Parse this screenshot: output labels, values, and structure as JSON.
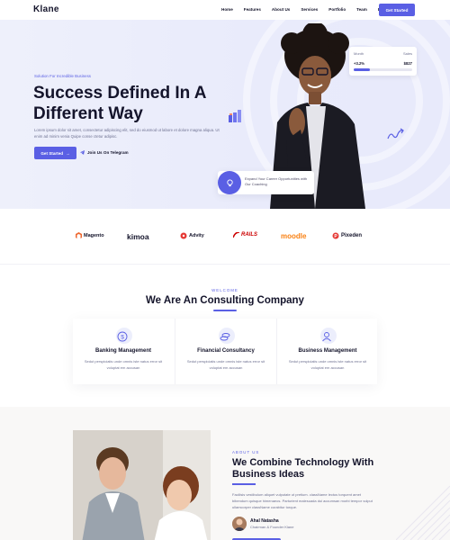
{
  "brand": "Klane",
  "nav": {
    "items": [
      "Home",
      "Features",
      "About Us",
      "Services",
      "Portfolio",
      "Team",
      "Blog"
    ],
    "cta": "Get Started"
  },
  "hero": {
    "tag": "Solution For Incredible Business",
    "title": "Success Defined In A Different Way",
    "description": "Lorem ipsum dolor sit amet, consectetur adipiscing elit, sed do eiusmod ut labore et dolore magna aliqua. Ut enim ad minim venia Quipe conse ctetur adipisc.",
    "cta": "Get Started",
    "cta_arrow": "→",
    "telegram": "Join Us On Telegram",
    "stats": {
      "label_left": "Month",
      "label_right": "Sales",
      "growth": "+3.2%",
      "amount": "$827",
      "progress": 0.28
    },
    "coach_text": "Expand Your Career Opportunities with Our Coaching",
    "accent": "#5a5fe4"
  },
  "logos": [
    {
      "name": "Magento",
      "icon": "magento-icon",
      "color": "#ee672f"
    },
    {
      "name": "kimoa",
      "icon": "",
      "color": "#14142b"
    },
    {
      "name": "Advity",
      "icon": "advity-icon",
      "color": "#e53935"
    },
    {
      "name": "RAILS",
      "icon": "rails-icon",
      "color": "#cc0000"
    },
    {
      "name": "moodle",
      "icon": "moodle-icon",
      "color": "#f98012"
    },
    {
      "name": "Pixeden",
      "icon": "pixeden-icon",
      "color": "#e53935"
    }
  ],
  "consulting": {
    "tag": "WELCOME",
    "title": "We Are An Consulting Company",
    "services": [
      {
        "title": "Banking Management",
        "icon": "dollar-icon",
        "desc": "Sedut perspiciatis unde omnis iste natus error sit voluptat em accusan"
      },
      {
        "title": "Financial Consultancy",
        "icon": "coins-icon",
        "desc": "Sedut perspiciatis unde omnis iste natus error sit voluptat em accusan"
      },
      {
        "title": "Business Management",
        "icon": "user-icon",
        "desc": "Sedut perspiciatis unde omnis iste natus error sit voluptat em accusan"
      }
    ]
  },
  "about": {
    "tag": "ABOUT US",
    "title": "We Combine Technology With Business Ideas",
    "description": "Facilisis vestibulum aliquet vulputate ut pretium. className lectus torquent amet bibendum quisque himenaeos. Parturient malesuada dui accumsan morbi tempor vulput ullamcorper className curabitur torque.",
    "author_name": "Ahal Natasha",
    "author_role": "Chairman & Founder Klane"
  }
}
